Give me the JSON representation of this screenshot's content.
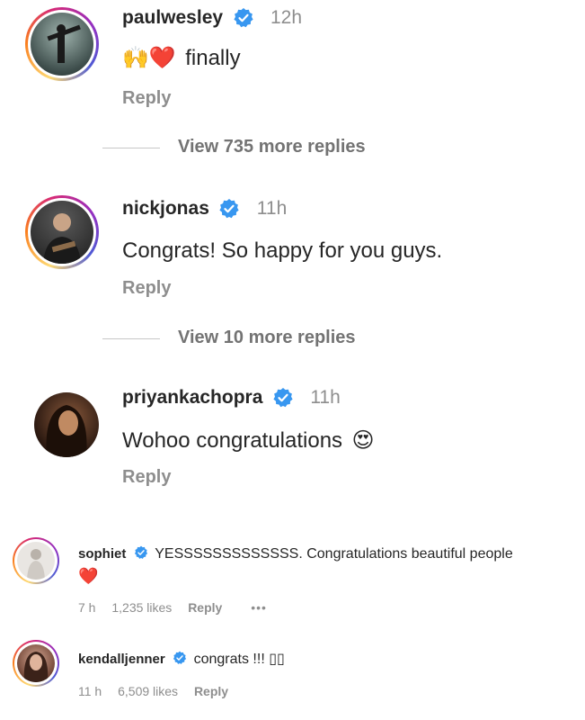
{
  "comments": [
    {
      "username": "paulwesley",
      "time": "12h",
      "text": "finally",
      "emoji": "🙌❤️",
      "reply": "Reply",
      "more": "View 735 more replies"
    },
    {
      "username": "nickjonas",
      "time": "11h",
      "text": "Congrats! So happy for you guys.",
      "reply": "Reply",
      "more": "View 10 more replies"
    },
    {
      "username": "priyankachopra",
      "time": "11h",
      "text": "Wohoo congratulations",
      "emoji": "😍",
      "reply": "Reply"
    }
  ],
  "small_comments": [
    {
      "username": "sophiet",
      "text": "YESSSSSSSSSSSSS. Congratulations beautiful people",
      "emoji": "❤️",
      "time": "7 h",
      "likes": "1,235 likes",
      "reply": "Reply",
      "more": "•••"
    },
    {
      "username": "kendalljenner",
      "text": "congrats !!! ▯▯",
      "time": "11 h",
      "likes": "6,509 likes",
      "reply": "Reply"
    }
  ],
  "colors": {
    "verified": "#3897f0",
    "heart": "#ed4956",
    "text": "#262626",
    "muted": "#8e8e8e"
  }
}
